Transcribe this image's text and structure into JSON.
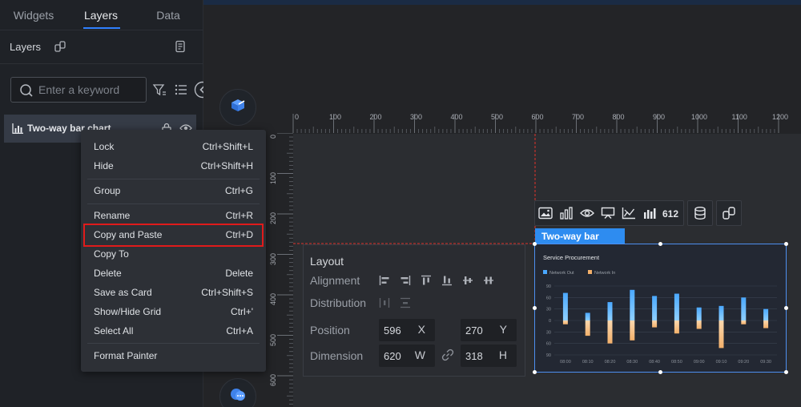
{
  "tabs": [
    {
      "label": "Widgets",
      "active": false
    },
    {
      "label": "Layers",
      "active": true
    },
    {
      "label": "Data",
      "active": false
    }
  ],
  "layers_panel": {
    "title": "Layers",
    "search_placeholder": "Enter a keyword",
    "items": [
      {
        "label": "Two-way bar chart",
        "icon": "bar-chart-icon"
      }
    ]
  },
  "context_menu": {
    "items": [
      {
        "label": "Lock",
        "shortcut": "Ctrl+Shift+L"
      },
      {
        "label": "Hide",
        "shortcut": "Ctrl+Shift+H"
      },
      {
        "label": "Group",
        "shortcut": "Ctrl+G"
      },
      {
        "label": "Rename",
        "shortcut": "Ctrl+R"
      },
      {
        "label": "Copy and Paste",
        "shortcut": "Ctrl+D",
        "highlighted": true
      },
      {
        "label": "Copy To",
        "shortcut": ""
      },
      {
        "label": "Delete",
        "shortcut": "Delete"
      },
      {
        "label": "Save as Card",
        "shortcut": "Ctrl+Shift+S"
      },
      {
        "label": "Show/Hide Grid",
        "shortcut": "Ctrl+'"
      },
      {
        "label": "Select All",
        "shortcut": "Ctrl+A"
      },
      {
        "label": "Format Painter",
        "shortcut": ""
      }
    ],
    "highlight_color": "#e01b1b"
  },
  "rulers": {
    "top": [
      "0",
      "100",
      "200",
      "300",
      "400",
      "500",
      "600",
      "700",
      "800",
      "900",
      "1000",
      "1100",
      "1200"
    ],
    "left": [
      "0",
      "100",
      "200",
      "300",
      "400",
      "500",
      "600"
    ]
  },
  "layout_panel": {
    "title": "Layout",
    "alignment_label": "Alignment",
    "distribution_label": "Distribution",
    "position_label": "Position",
    "dimension_label": "Dimension",
    "x_value": "596",
    "x_axis": "X",
    "y_value": "270",
    "y_axis": "Y",
    "w_value": "620",
    "w_axis": "W",
    "h_value": "318",
    "h_axis": "H"
  },
  "widget": {
    "tag_label": "Two-way bar chart",
    "accent_color": "#2e8cf0"
  },
  "chart_data": {
    "type": "bar",
    "title": "Service Procurement",
    "categories": [
      "08:00",
      "08:10",
      "08:20",
      "08:30",
      "08:40",
      "08:50",
      "09:00",
      "09:10",
      "09:20",
      "09:30"
    ],
    "series": [
      {
        "name": "Network Out",
        "color": "#4aa8ff",
        "values": [
          72,
          20,
          48,
          80,
          64,
          70,
          34,
          38,
          60,
          30
        ]
      },
      {
        "name": "Network In",
        "color": "#f3b06a",
        "values": [
          -10,
          -40,
          -60,
          -52,
          -18,
          -34,
          -22,
          -72,
          -10,
          -20
        ]
      }
    ],
    "yticks": [
      "90",
      "60",
      "30",
      "0",
      "30",
      "60",
      "90"
    ],
    "ylim": [
      -90,
      90
    ]
  }
}
